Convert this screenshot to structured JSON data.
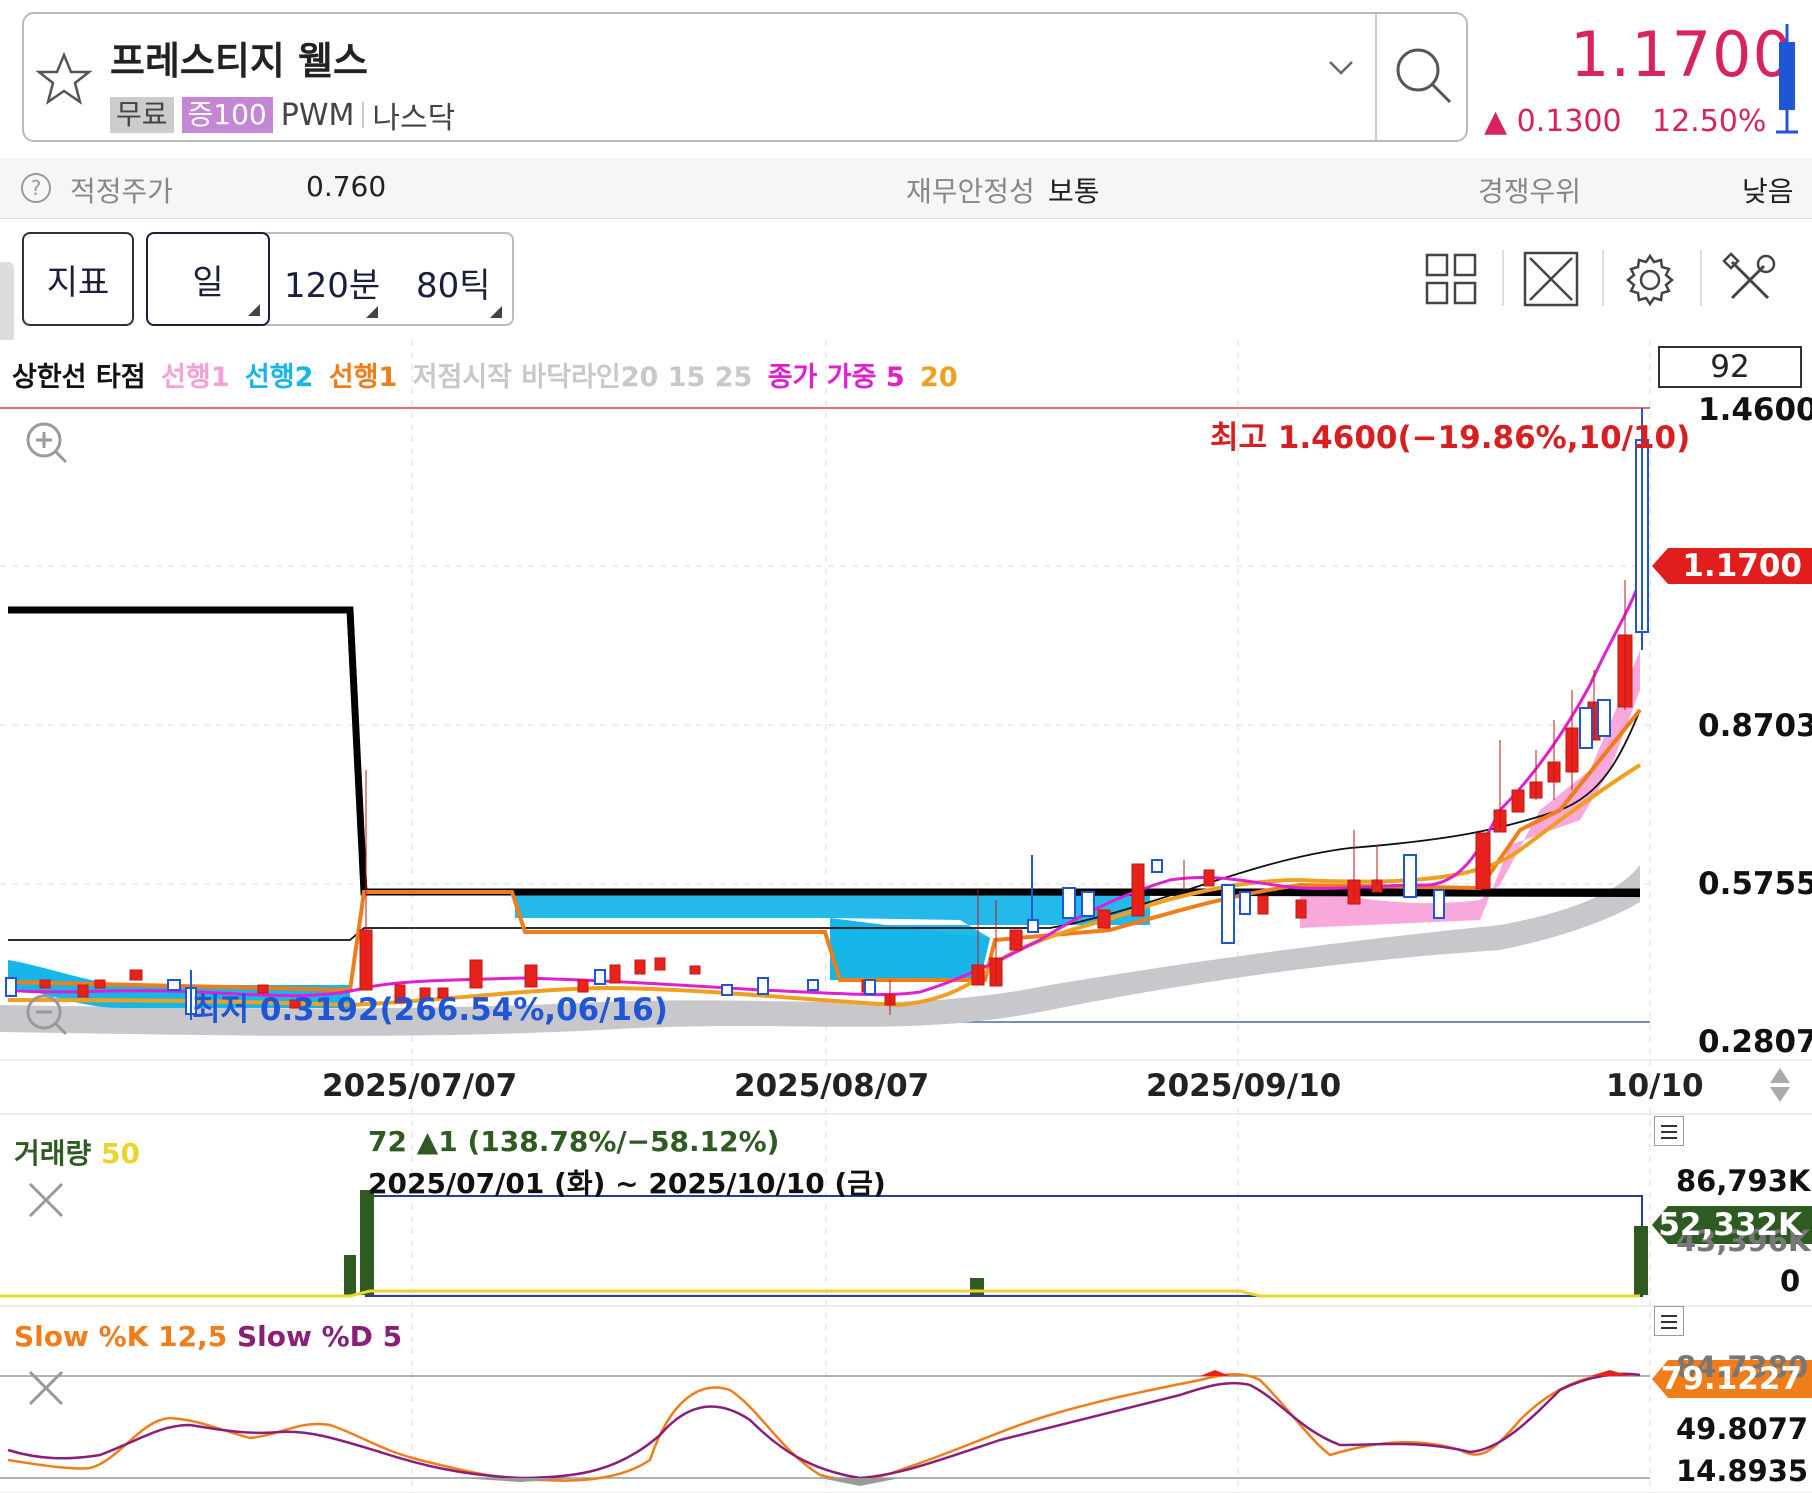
{
  "header": {
    "stock_name": "프레스티지 웰스",
    "badges": [
      "무료",
      "증100"
    ],
    "ticker": "PWM",
    "exchange": "나스닥",
    "price": "1.1700",
    "change": "▲ 0.1300",
    "change_pct": "12.50%",
    "accent_color": "#d8245c"
  },
  "valuation": {
    "fair_price_label": "적정주가",
    "fair_price_value": "0.760",
    "stability_label": "재무안정성",
    "stability_value": "보통",
    "competition_label": "경쟁우위",
    "competition_value": "낮음"
  },
  "toolbar": {
    "indicator_label": "지표",
    "periods": [
      "일",
      "120분",
      "80틱"
    ],
    "icons": [
      "grid-layout-icon",
      "expand-icon",
      "settings-gear-icon",
      "tools-icon"
    ]
  },
  "legend": [
    {
      "text": "상한선 타점",
      "color": "#111111"
    },
    {
      "text": "선행1",
      "color": "#f79fd6"
    },
    {
      "text": "선행2",
      "color": "#17b6e8"
    },
    {
      "text": "선행1",
      "color": "#f07d1a"
    },
    {
      "text": "저점시작 바닥라인20 15 25",
      "color": "#c8c8c8"
    },
    {
      "text": "종가 가중 5",
      "color": "#e01fd0"
    },
    {
      "text": "20",
      "color": "#f0a020"
    }
  ],
  "price_chart": {
    "badge_value": "92",
    "y_labels": [
      "1.4600",
      "0.8703",
      "0.5755",
      "0.2807"
    ],
    "current_tag": "1.1700",
    "high_annotation": "최고 1.4600(−19.86%,10/10)",
    "low_annotation": "최저 0.3192(266.54%,06/16)",
    "x_labels": [
      "2025/07/07",
      "2025/08/07",
      "2025/09/10",
      "10/10"
    ]
  },
  "volume": {
    "title": "거래량",
    "ma_period": "50",
    "info_line1": "72 ▲1 (138.78%/−58.12%)",
    "info_line2": "2025/07/01 (화) ~ 2025/10/10 (금)",
    "y_labels": [
      "86,793K",
      "43,396K",
      "0"
    ],
    "current_tag": "52,332K"
  },
  "stochastic": {
    "title_k": "Slow %K 12,5",
    "title_d": "Slow %D 5",
    "y_labels": [
      "84.7380",
      "49.8077",
      "14.8935"
    ],
    "current_tag": "79.1227"
  },
  "chart_data": {
    "type": "candlestick",
    "period": "daily",
    "range": "2025/06 ~ 2025/10/10",
    "ohlc_approx": [
      {
        "date": "2025/06/16",
        "low": 0.3192
      },
      {
        "date": "2025/07/01",
        "open": 0.33,
        "high": 0.82,
        "low": 0.33,
        "close": 0.4
      },
      {
        "date": "2025/08/20",
        "open": 0.38,
        "high": 0.54,
        "low": 0.37,
        "close": 0.44
      },
      {
        "date": "2025/09/05",
        "open": 0.52,
        "high": 0.62,
        "low": 0.5,
        "close": 0.61
      },
      {
        "date": "2025/10/01",
        "open": 0.56,
        "high": 0.68,
        "low": 0.55,
        "close": 0.67
      },
      {
        "date": "2025/10/09",
        "open": 0.92,
        "high": 1.25,
        "low": 0.92,
        "close": 1.04
      },
      {
        "date": "2025/10/10",
        "open": 1.04,
        "high": 1.46,
        "low": 0.95,
        "close": 1.17
      }
    ],
    "ylim": [
      0.2807,
      1.46
    ],
    "volume_ylim": [
      0,
      86793
    ],
    "volume_current_k": 52332,
    "stoch_current_k": 79.1227
  }
}
